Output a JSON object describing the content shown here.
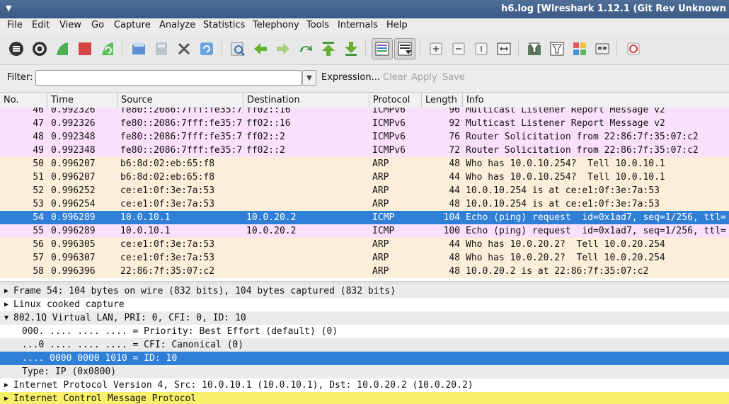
{
  "window": {
    "title": "h6.log  [Wireshark 1.12.1  (Git Rev Unknown",
    "menu_glyph": "▼"
  },
  "menu": [
    "File",
    "Edit",
    "View",
    "Go",
    "Capture",
    "Analyze",
    "Statistics",
    "Telephony",
    "Tools",
    "Internals",
    "Help"
  ],
  "toolbar_icons": [
    "interfaces-icon",
    "options-icon",
    "start-capture-icon",
    "stop-capture-icon",
    "restart-capture-icon",
    "open-file-icon",
    "save-file-icon",
    "close-file-icon",
    "reload-icon",
    "find-packet-icon",
    "go-back-icon",
    "go-forward-icon",
    "go-to-packet-icon",
    "go-first-icon",
    "go-last-icon",
    "colorize-icon",
    "autoscroll-icon",
    "zoom-in-icon",
    "zoom-out-icon",
    "normal-size-icon",
    "resize-columns-icon",
    "capture-filters-icon",
    "display-filters-icon",
    "coloring-rules-icon",
    "preferences-icon",
    "help-icon"
  ],
  "filter": {
    "label": "Filter:",
    "value": "",
    "expression": "Expression...",
    "clear": "Clear",
    "apply": "Apply",
    "save": "Save"
  },
  "columns": [
    "No.",
    "Time",
    "Source",
    "Destination",
    "Protocol",
    "Length",
    "Info"
  ],
  "packets": [
    {
      "no": "46",
      "time": "0.992326",
      "src": "fe80::2086:7fff:fe35:7",
      "dst": "ff02::16",
      "proto": "ICMPv6",
      "len": "96",
      "info": "Multicast Listener Report Message v2",
      "bg": "#fbe0fb",
      "sel": false
    },
    {
      "no": "47",
      "time": "0.992326",
      "src": "fe80::2086:7fff:fe35:7",
      "dst": "ff02::16",
      "proto": "ICMPv6",
      "len": "92",
      "info": "Multicast Listener Report Message v2",
      "bg": "#fbe0fb",
      "sel": false
    },
    {
      "no": "48",
      "time": "0.992348",
      "src": "fe80::2086:7fff:fe35:7",
      "dst": "ff02::2",
      "proto": "ICMPv6",
      "len": "76",
      "info": "Router Solicitation from 22:86:7f:35:07:c2",
      "bg": "#fbe0fb",
      "sel": false
    },
    {
      "no": "49",
      "time": "0.992348",
      "src": "fe80::2086:7fff:fe35:7",
      "dst": "ff02::2",
      "proto": "ICMPv6",
      "len": "72",
      "info": "Router Solicitation from 22:86:7f:35:07:c2",
      "bg": "#fbe0fb",
      "sel": false
    },
    {
      "no": "50",
      "time": "0.996207",
      "src": "b6:8d:02:eb:65:f8",
      "dst": "",
      "proto": "ARP",
      "len": "48",
      "info": "Who has 10.0.10.254?  Tell 10.0.10.1",
      "bg": "#fbefd9",
      "sel": false
    },
    {
      "no": "51",
      "time": "0.996207",
      "src": "b6:8d:02:eb:65:f8",
      "dst": "",
      "proto": "ARP",
      "len": "44",
      "info": "Who has 10.0.10.254?  Tell 10.0.10.1",
      "bg": "#fbefd9",
      "sel": false
    },
    {
      "no": "52",
      "time": "0.996252",
      "src": "ce:e1:0f:3e:7a:53",
      "dst": "",
      "proto": "ARP",
      "len": "44",
      "info": "10.0.10.254 is at ce:e1:0f:3e:7a:53",
      "bg": "#fbefd9",
      "sel": false
    },
    {
      "no": "53",
      "time": "0.996254",
      "src": "ce:e1:0f:3e:7a:53",
      "dst": "",
      "proto": "ARP",
      "len": "48",
      "info": "10.0.10.254 is at ce:e1:0f:3e:7a:53",
      "bg": "#fbefd9",
      "sel": false
    },
    {
      "no": "54",
      "time": "0.996289",
      "src": "10.0.10.1",
      "dst": "10.0.20.2",
      "proto": "ICMP",
      "len": "104",
      "info": "Echo (ping) request  id=0x1ad7, seq=1/256, ttl=",
      "bg": "#2f7fd7",
      "sel": true
    },
    {
      "no": "55",
      "time": "0.996289",
      "src": "10.0.10.1",
      "dst": "10.0.20.2",
      "proto": "ICMP",
      "len": "100",
      "info": "Echo (ping) request  id=0x1ad7, seq=1/256, ttl=",
      "bg": "#fbe0fb",
      "sel": false
    },
    {
      "no": "56",
      "time": "0.996305",
      "src": "ce:e1:0f:3e:7a:53",
      "dst": "",
      "proto": "ARP",
      "len": "44",
      "info": "Who has 10.0.20.2?  Tell 10.0.20.254",
      "bg": "#fbefd9",
      "sel": false
    },
    {
      "no": "57",
      "time": "0.996307",
      "src": "ce:e1:0f:3e:7a:53",
      "dst": "",
      "proto": "ARP",
      "len": "48",
      "info": "Who has 10.0.20.2?  Tell 10.0.20.254",
      "bg": "#fbefd9",
      "sel": false
    },
    {
      "no": "58",
      "time": "0.996396",
      "src": "22:86:7f:35:07:c2",
      "dst": "",
      "proto": "ARP",
      "len": "48",
      "info": "10.0.20.2 is at 22:86:7f:35:07:c2",
      "bg": "#fbefd9",
      "sel": false
    }
  ],
  "details": [
    {
      "text": "Frame 54: 104 bytes on wire (832 bits), 104 bytes captured (832 bits)",
      "arrow": "▶",
      "child": false,
      "sel": false,
      "bg": "#ebebeb"
    },
    {
      "text": "Linux cooked capture",
      "arrow": "▶",
      "child": false,
      "sel": false,
      "bg": "#ffffff"
    },
    {
      "text": "802.1Q Virtual LAN, PRI: 0, CFI: 0, ID: 10",
      "arrow": "▼",
      "child": false,
      "sel": false,
      "bg": "#ebebeb"
    },
    {
      "text": "000. .... .... .... = Priority: Best Effort (default) (0)",
      "arrow": "",
      "child": true,
      "sel": false,
      "bg": "#ffffff"
    },
    {
      "text": "...0 .... .... .... = CFI: Canonical (0)",
      "arrow": "",
      "child": true,
      "sel": false,
      "bg": "#ebebeb"
    },
    {
      "text": ".... 0000 0000 1010 = ID: 10",
      "arrow": "",
      "child": true,
      "sel": true,
      "bg": "#2f7fd7"
    },
    {
      "text": "Type: IP (0x0800)",
      "arrow": "",
      "child": true,
      "sel": false,
      "bg": "#ebebeb"
    },
    {
      "text": "Internet Protocol Version 4, Src: 10.0.10.1 (10.0.10.1), Dst: 10.0.20.2 (10.0.20.2)",
      "arrow": "▶",
      "child": false,
      "sel": false,
      "bg": "#ffffff"
    },
    {
      "text": "Internet Control Message Protocol",
      "arrow": "▶",
      "child": false,
      "sel": false,
      "bg": "#f7f06a"
    }
  ]
}
